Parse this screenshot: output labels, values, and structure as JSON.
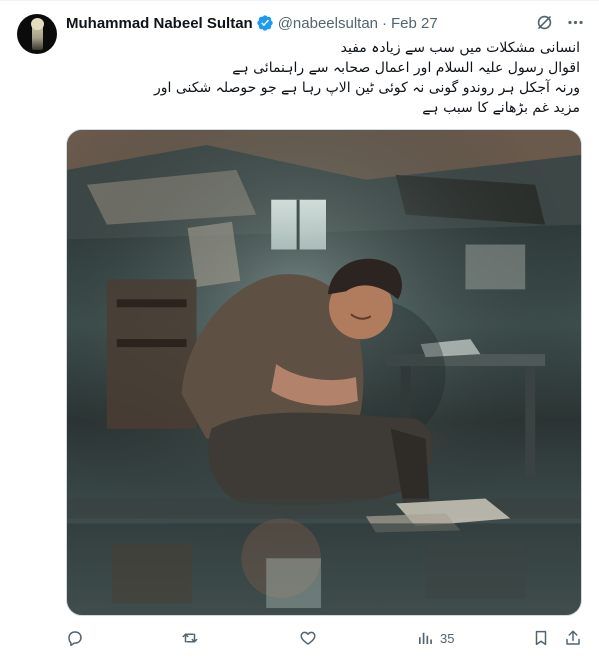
{
  "tweet": {
    "author_name": "Muhammad Nabeel Sultan",
    "handle": "@nabeelsultan",
    "separator": "·",
    "date": "Feb 27",
    "text_lines": [
      "انسانی مشکلات میں سب سے زیادہ مفید",
      "اقوال رسول علیہ السلام اور اعمال صحابہ سے راہنمائی ہے",
      "ورنہ آجکل ہر روندو گونی نہ کوئی ٹین الاپ رہا ہے جو حوصلہ شکنی اور",
      "مزید غم بڑھانے کا سبب ہے"
    ],
    "views_count": "35"
  },
  "icons": {
    "verified": "verified-badge-icon",
    "grok": "grok-icon",
    "more": "more-icon",
    "reply": "reply-icon",
    "retweet": "retweet-icon",
    "like": "like-icon",
    "views": "views-icon",
    "bookmark": "bookmark-icon",
    "share": "share-icon"
  },
  "colors": {
    "accent": "#1d9bf0",
    "muted": "#536471",
    "text": "#0f1419"
  }
}
